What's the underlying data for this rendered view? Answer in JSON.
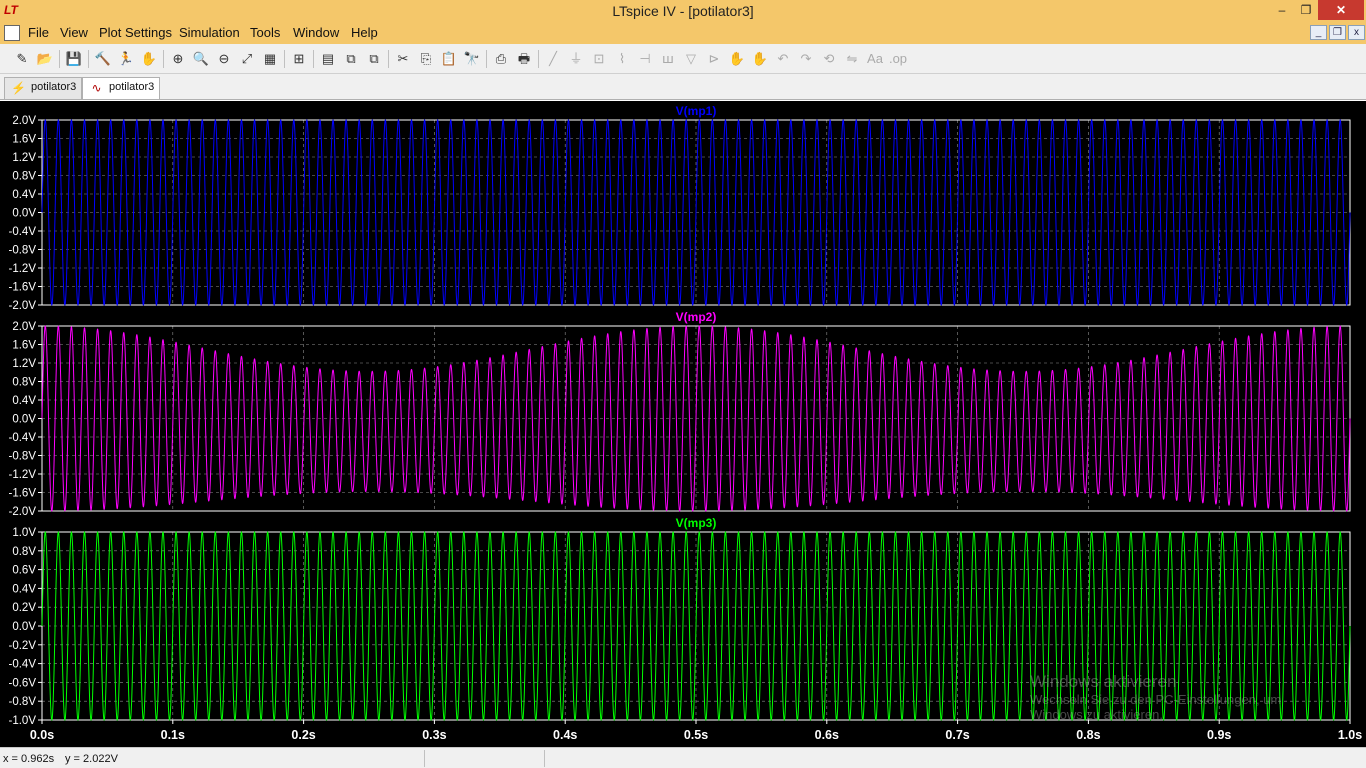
{
  "window": {
    "title": "LTspice IV - [potilator3]",
    "logo": "LT",
    "minimize": "–",
    "maximize": "❐",
    "close": "✕"
  },
  "menu": [
    "File",
    "View",
    "Plot Settings",
    "Simulation",
    "Tools",
    "Window",
    "Help"
  ],
  "mdi": {
    "minimize": "_",
    "restore": "❐",
    "close": "x"
  },
  "toolbar": [
    {
      "name": "new-schematic-icon",
      "glyph": "✎"
    },
    {
      "name": "open-icon",
      "glyph": "📂"
    },
    {
      "name": "save-icon",
      "glyph": "💾"
    },
    {
      "name": "control-panel-icon",
      "glyph": "🔨"
    },
    {
      "name": "run-icon",
      "glyph": "🏃"
    },
    {
      "name": "pan-icon",
      "glyph": "✋"
    },
    {
      "name": "zoom-in-icon",
      "glyph": "⊕"
    },
    {
      "name": "zoom-area-icon",
      "glyph": "🔍"
    },
    {
      "name": "zoom-out-icon",
      "glyph": "⊖"
    },
    {
      "name": "zoom-fit-icon",
      "glyph": "⤢"
    },
    {
      "name": "autorange-icon",
      "glyph": "▦"
    },
    {
      "name": "grid-icon",
      "glyph": "⊞"
    },
    {
      "name": "tile-horizontal-icon",
      "glyph": "▤"
    },
    {
      "name": "cascade-icon",
      "glyph": "⧉"
    },
    {
      "name": "tile-vertical-icon",
      "glyph": "⧉"
    },
    {
      "name": "cut-icon",
      "glyph": "✂"
    },
    {
      "name": "copy-icon",
      "glyph": "⎘"
    },
    {
      "name": "paste-icon",
      "glyph": "📋"
    },
    {
      "name": "find-icon",
      "glyph": "🔭"
    },
    {
      "name": "print-preview-icon",
      "glyph": "⎙"
    },
    {
      "name": "print-icon",
      "glyph": "🖶"
    },
    {
      "name": "wire-icon",
      "glyph": "╱"
    },
    {
      "name": "ground-icon",
      "glyph": "⏚"
    },
    {
      "name": "label-net-icon",
      "glyph": "⊡"
    },
    {
      "name": "resistor-icon",
      "glyph": "⌇"
    },
    {
      "name": "capacitor-icon",
      "glyph": "⊣"
    },
    {
      "name": "inductor-icon",
      "glyph": "ꟺ"
    },
    {
      "name": "diode-icon",
      "glyph": "▽"
    },
    {
      "name": "component-icon",
      "glyph": "⊳"
    },
    {
      "name": "move-icon",
      "glyph": "✋"
    },
    {
      "name": "drag-icon",
      "glyph": "✋"
    },
    {
      "name": "undo-icon",
      "glyph": "↶"
    },
    {
      "name": "redo-icon",
      "glyph": "↷"
    },
    {
      "name": "rotate-icon",
      "glyph": "⟲"
    },
    {
      "name": "mirror-icon",
      "glyph": "⇋"
    },
    {
      "name": "text-icon",
      "glyph": "Aa"
    },
    {
      "name": "spice-directive-icon",
      "glyph": ".op"
    }
  ],
  "tabs": [
    {
      "label": "potilator3",
      "kind": "schematic"
    },
    {
      "label": "potilator3",
      "kind": "waveform"
    }
  ],
  "chart_data": [
    {
      "type": "line",
      "title": "V(mp1)",
      "color": "#0000ff",
      "ylim": [
        -2.0,
        2.0
      ],
      "yticks": [
        "2.0V",
        "1.6V",
        "1.2V",
        "0.8V",
        "0.4V",
        "0.0V",
        "-0.4V",
        "-0.8V",
        "-1.2V",
        "-1.6V",
        "-2.0V"
      ],
      "xlim": [
        0,
        1.0
      ],
      "series": [
        {
          "name": "V(mp1)",
          "frequency_hz": 100,
          "amplitude": 2.0
        }
      ]
    },
    {
      "type": "line",
      "title": "V(mp2)",
      "color": "#ff00ff",
      "ylim": [
        -2.0,
        2.0
      ],
      "yticks": [
        "2.0V",
        "1.6V",
        "1.2V",
        "0.8V",
        "0.4V",
        "0.0V",
        "-0.4V",
        "-0.8V",
        "-1.2V",
        "-1.6V",
        "-2.0V"
      ],
      "xlim": [
        0,
        1.0
      ],
      "series": [
        {
          "name": "V(mp2)",
          "frequency_hz": 100,
          "amplitude_max": 2.0,
          "amplitude_min": 1.3,
          "modulation_hz": 2,
          "offset_v": -0.28,
          "offset_modulation_hz": 2
        }
      ]
    },
    {
      "type": "line",
      "title": "V(mp3)",
      "color": "#00ff00",
      "ylim": [
        -1.0,
        1.0
      ],
      "yticks": [
        "1.0V",
        "0.8V",
        "0.6V",
        "0.4V",
        "0.2V",
        "0.0V",
        "-0.2V",
        "-0.4V",
        "-0.6V",
        "-0.8V",
        "-1.0V"
      ],
      "xlim": [
        0,
        1.0
      ],
      "series": [
        {
          "name": "V(mp3)",
          "frequency_hz": 100,
          "amplitude": 1.0
        }
      ]
    }
  ],
  "xticks": [
    "0.0s",
    "0.1s",
    "0.2s",
    "0.3s",
    "0.4s",
    "0.5s",
    "0.6s",
    "0.7s",
    "0.8s",
    "0.9s",
    "1.0s"
  ],
  "plot_colors": {
    "background": "#000000",
    "grid": "#909090",
    "text": "#ffffff"
  },
  "watermark": {
    "title": "Windows aktivieren",
    "line1": "Wechseln Sie zu den PC-Einstellungen, um",
    "line2": "Windows zu aktivieren."
  },
  "status": {
    "x": "x = 0.962s",
    "y": "y = 2.022V"
  }
}
